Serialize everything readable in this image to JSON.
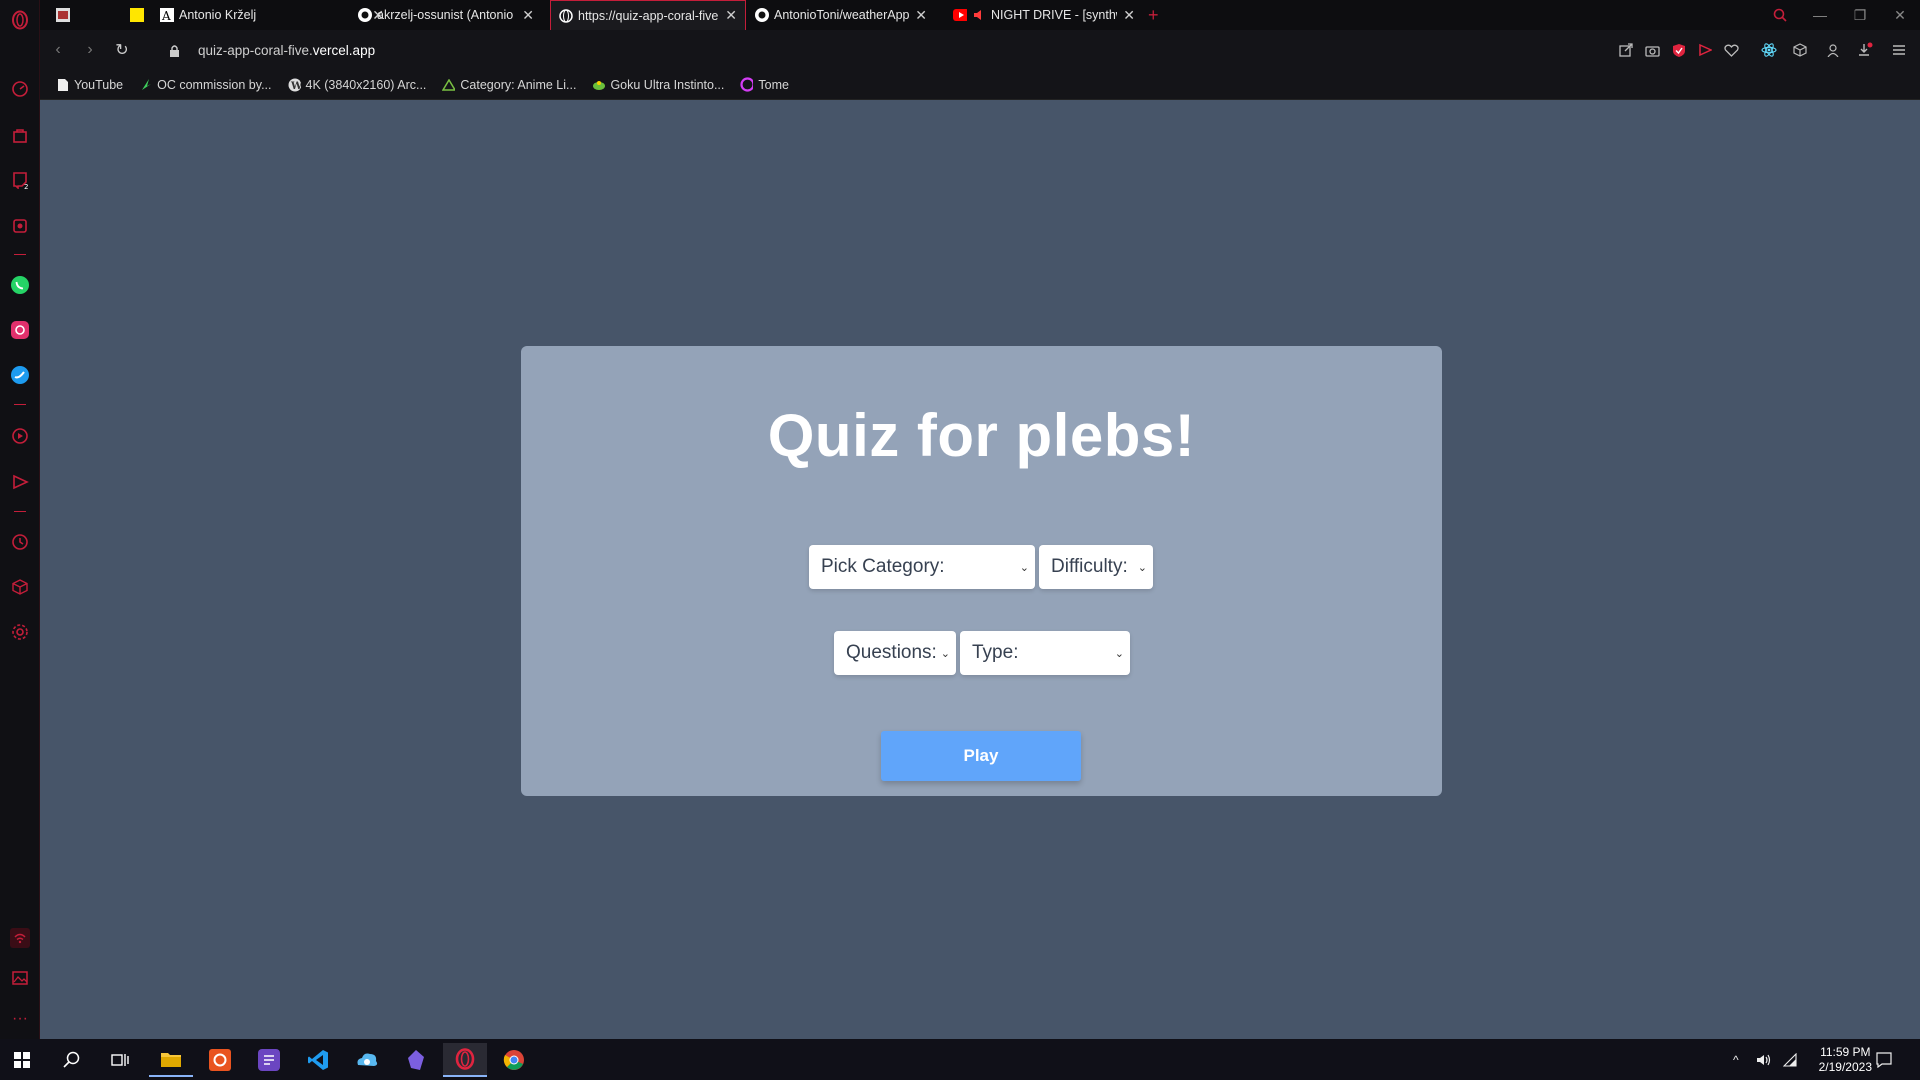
{
  "browser": {
    "tabs": [
      {
        "title": "",
        "favicon": "pinned-image-icon",
        "close": false
      },
      {
        "title": "",
        "favicon": "pinned-yellow-icon",
        "close": false
      },
      {
        "title": "Antonio Krželj",
        "favicon": "profile-favicon",
        "close": true
      },
      {
        "title": "akrzelj-ossunist (Antonio K",
        "favicon": "github-icon",
        "close": true
      },
      {
        "title": "https://quiz-app-coral-five.",
        "favicon": "globe-icon",
        "close": true,
        "active": true
      },
      {
        "title": "AntonioToni/weatherApp: W",
        "favicon": "github-icon",
        "close": true
      },
      {
        "title": "NIGHT DRIVE - [synthwave",
        "favicon": "youtube-icon",
        "close": true,
        "audio": true
      }
    ],
    "new_tab": "+",
    "url_domain": "quiz-app-coral-five.",
    "url_rest": "vercel.app",
    "bookmarks": [
      {
        "label": "YouTube",
        "icon": "page-icon"
      },
      {
        "label": "OC commission by...",
        "icon": "leaf-icon"
      },
      {
        "label": "4K (3840x2160) Arc...",
        "icon": "wordpress-icon"
      },
      {
        "label": "Category: Anime Li...",
        "icon": "cycle-icon"
      },
      {
        "label": "Goku Ultra Instinto...",
        "icon": "dragon-icon"
      },
      {
        "label": "Tome",
        "icon": "tome-icon"
      }
    ]
  },
  "quiz": {
    "title": "Quiz for plebs!",
    "category_placeholder": "Pick Category:",
    "difficulty_placeholder": "Difficulty:",
    "questions_placeholder": "Questions:",
    "type_placeholder": "Type:",
    "play_label": "Play"
  },
  "taskbar": {
    "time": "11:59 PM",
    "date": "2/19/2023"
  },
  "colors": {
    "page_bg": "#475569",
    "card_bg": "#94a3b8",
    "play_bg": "#60a5fa",
    "opera_red": "#c41e3a"
  }
}
